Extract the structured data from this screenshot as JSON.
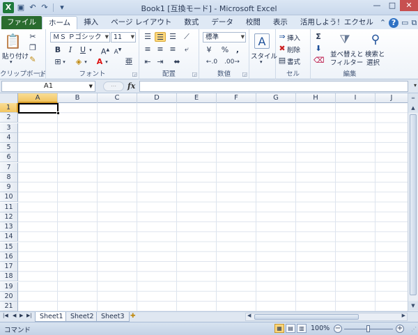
{
  "window": {
    "title": "Book1 [互換モード] - Microsoft Excel",
    "app_icon": "X",
    "minimize": "—",
    "maximize": "□",
    "close": "✕"
  },
  "ribbon_tabs": [
    {
      "label": "ファイル"
    },
    {
      "label": "ホーム"
    },
    {
      "label": "挿入"
    },
    {
      "label": "ページ レイアウト"
    },
    {
      "label": "数式"
    },
    {
      "label": "データ"
    },
    {
      "label": "校閲"
    },
    {
      "label": "表示"
    },
    {
      "label": "活用しよう！エクセル"
    }
  ],
  "ribbon": {
    "clipboard": {
      "label": "クリップボード",
      "paste": "貼り付け"
    },
    "font": {
      "label": "フォント",
      "name": "ＭＳ Ｐゴシック",
      "size": "11",
      "bold": "B",
      "italic": "I",
      "underline": "U"
    },
    "alignment": {
      "label": "配置"
    },
    "number": {
      "label": "数値",
      "format": "標準",
      "percent": "%",
      "comma": ","
    },
    "styles": {
      "label": "スタイル"
    },
    "cells": {
      "label": "セル",
      "insert": "挿入",
      "delete": "削除",
      "format": "書式"
    },
    "editing": {
      "label": "編集",
      "sort_filter_1": "並べ替えと",
      "sort_filter_2": "フィルター",
      "find_select_1": "検索と",
      "find_select_2": "選択",
      "sum": "Σ"
    }
  },
  "formula_bar": {
    "name_box": "A1",
    "fx": "fx",
    "value": ""
  },
  "columns": [
    "A",
    "B",
    "C",
    "D",
    "E",
    "F",
    "G",
    "H",
    "I",
    "J"
  ],
  "rows": [
    "1",
    "2",
    "3",
    "4",
    "5",
    "6",
    "7",
    "8",
    "9",
    "10",
    "11",
    "12",
    "13",
    "14",
    "15",
    "16",
    "17",
    "18",
    "19",
    "20",
    "21"
  ],
  "sheets": [
    {
      "label": "Sheet1"
    },
    {
      "label": "Sheet2"
    },
    {
      "label": "Sheet3"
    }
  ],
  "status": {
    "mode": "コマンド",
    "zoom": "100%"
  }
}
